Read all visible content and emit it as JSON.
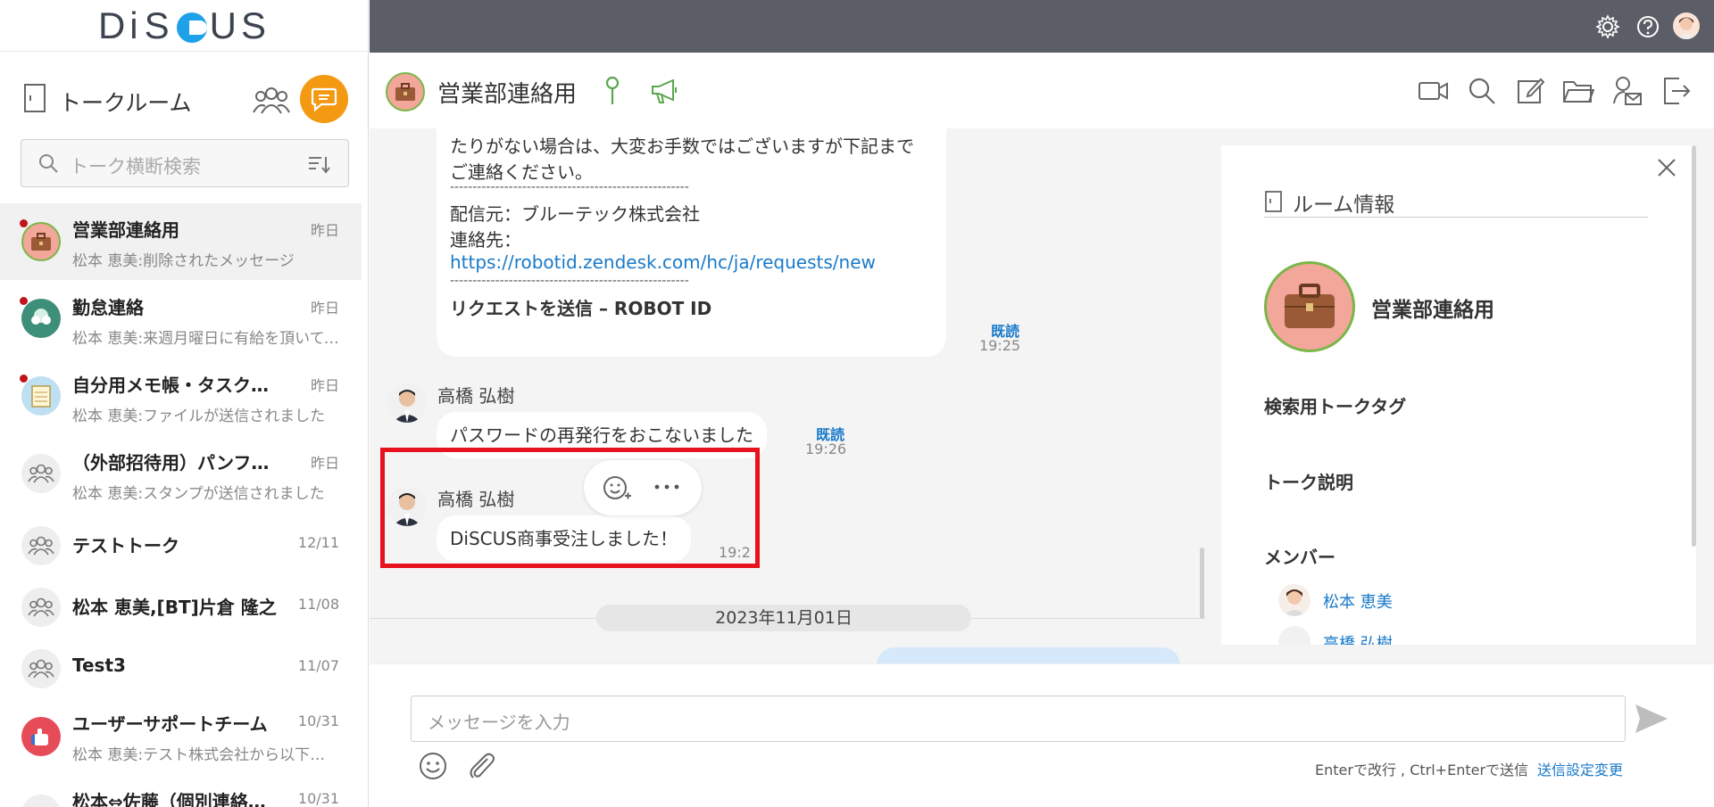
{
  "app": {
    "logo_text_left": "Di",
    "logo_text_right": "US",
    "logo_s": "S"
  },
  "left_panel": {
    "title": "トークルーム",
    "search_placeholder": "トーク横断検索",
    "rooms": [
      {
        "name": "営業部連絡用",
        "date": "昨日",
        "preview": "松本 恵美:削除されたメッセージ",
        "unread": true,
        "active": true,
        "avatar": "briefcase-icon"
      },
      {
        "name": "勤怠連絡",
        "date": "昨日",
        "preview": "松本 恵美:来週月曜日に有給を頂いても宜しいでしょうか",
        "unread": true,
        "active": false,
        "avatar": "group-photo-icon"
      },
      {
        "name": "自分用メモ帳・タスク管理",
        "date": "昨日",
        "preview": "松本 恵美:ファイルが送信されました",
        "unread": true,
        "active": false,
        "avatar": "notepad-icon"
      },
      {
        "name": "（外部招待用）パンフレット",
        "date": "昨日",
        "preview": "松本 恵美:スタンプが送信されました",
        "unread": false,
        "active": false,
        "avatar": "people-icon"
      },
      {
        "name": "テストトーク",
        "date": "12/11",
        "preview": "",
        "unread": false,
        "active": false,
        "avatar": "people-icon"
      },
      {
        "name": "松本 恵美,[BT]片倉 隆之",
        "date": "11/08",
        "preview": "",
        "unread": false,
        "active": false,
        "avatar": "people-icon"
      },
      {
        "name": "Test3",
        "date": "11/07",
        "preview": "",
        "unread": false,
        "active": false,
        "avatar": "people-icon"
      },
      {
        "name": "ユーザーサポートチーム",
        "date": "10/31",
        "preview": "松本 恵美:テスト株式会社から以下の問い合わせがありました",
        "unread": false,
        "active": false,
        "avatar": "thumbs-up-icon"
      },
      {
        "name": "松本⇔佐藤（個別連絡用）",
        "date": "10/31",
        "preview": "",
        "unread": false,
        "active": false,
        "avatar": "people-icon"
      }
    ]
  },
  "chat": {
    "room_name": "営業部連絡用",
    "first_message": {
      "line1": "たりがない場合は、大変お手数ではございますが下記まで",
      "line2": "ご連絡ください。",
      "sep1": "-----------------------------------------------------",
      "from_line": "配信元：ブルーテック株式会社",
      "contact_line": "連絡先：",
      "link": "https://robotid.zendesk.com/hc/ja/requests/new",
      "sep2": "-----------------------------------------------------",
      "link_title": "リクエストを送信 – ROBOT ID",
      "read": "既読",
      "time": "19:25"
    },
    "second_message": {
      "sender": "高橋 弘樹",
      "text": "パスワードの再発行をおこないました",
      "read": "既読",
      "time": "19:26"
    },
    "third_message": {
      "sender": "高橋 弘樹",
      "text": "DiSCUS商事受注しました！",
      "time": "19:2"
    },
    "date_divider": "2023年11月01日",
    "input_placeholder": "メッセージを入力",
    "hint": "Enterで改行 , Ctrl+Enterで送信",
    "send_settings": "送信設定変更"
  },
  "info": {
    "title": "ルーム情報",
    "room_name": "営業部連絡用",
    "tag_label": "検索用トークタグ",
    "desc_label": "トーク説明",
    "members_label": "メンバー",
    "members": [
      "松本 恵美",
      "高橋 弘樹"
    ]
  },
  "colors": {
    "accent": "#f39a12",
    "topbar": "#5b5e66",
    "highlight": "#e8121f",
    "link": "#1a7ac9"
  }
}
